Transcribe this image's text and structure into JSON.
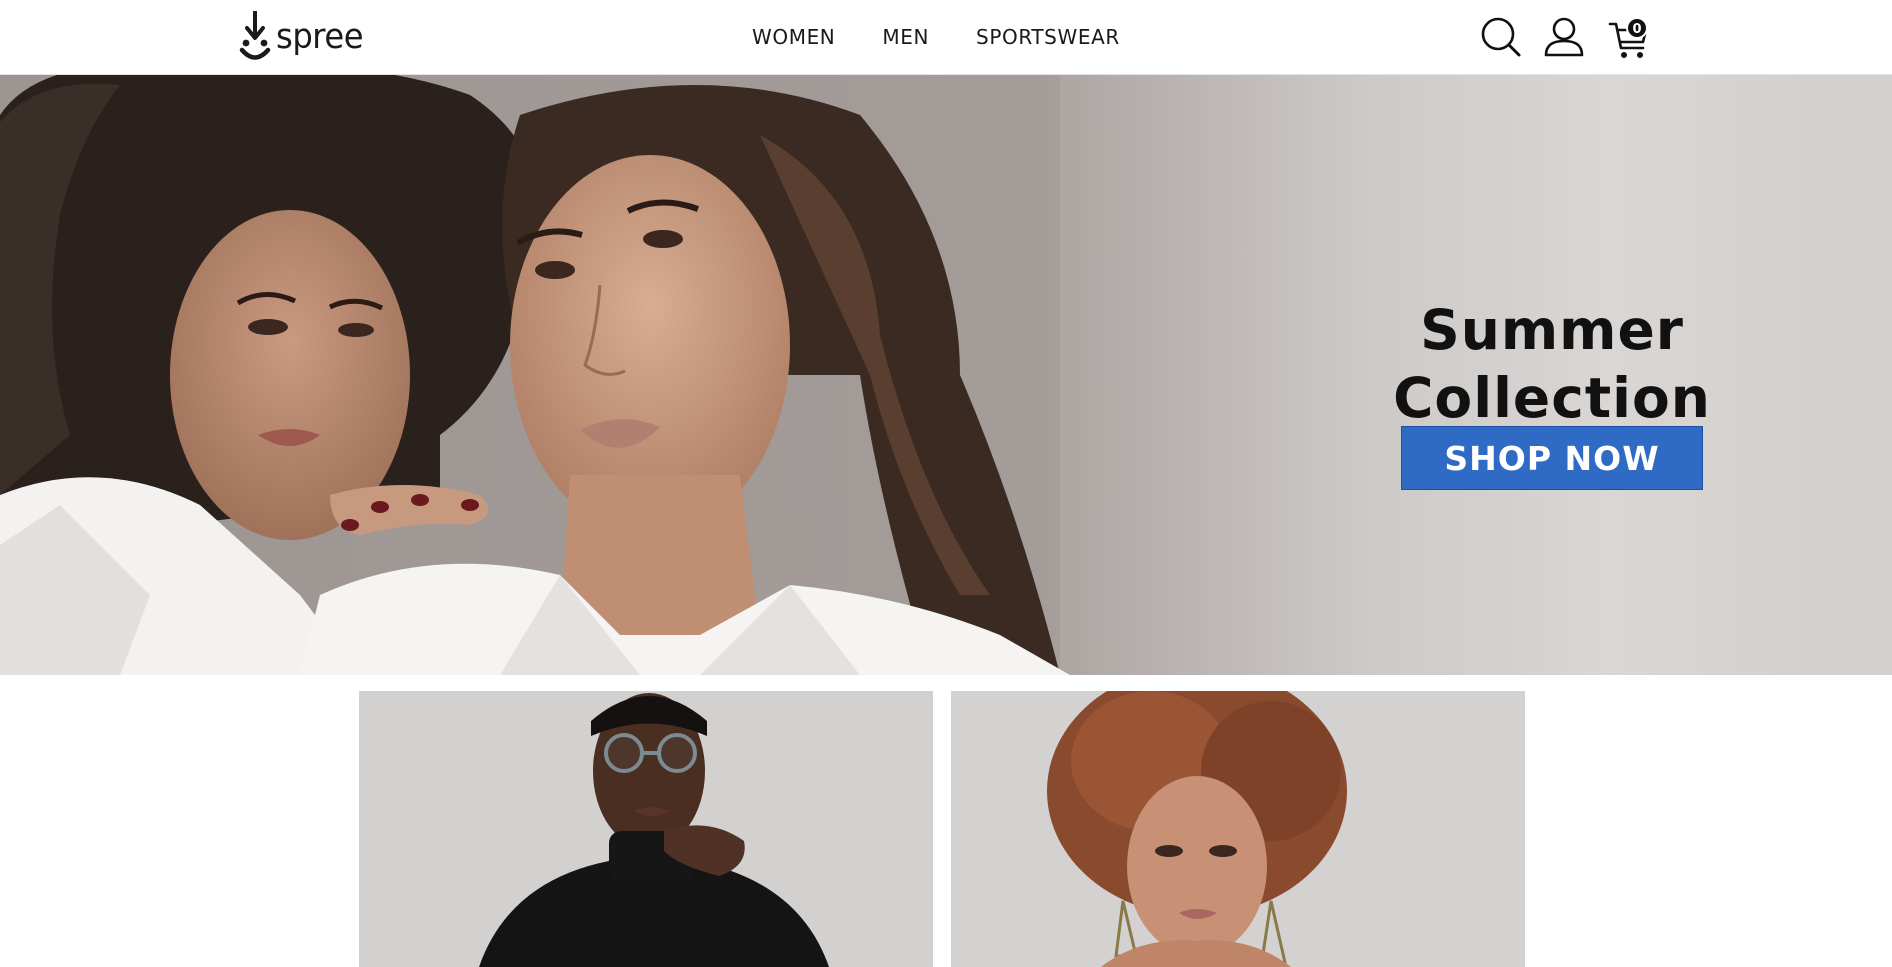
{
  "header": {
    "logo": {
      "text": "spree",
      "icon": "spree-logo-icon"
    },
    "nav": [
      {
        "label": "WOMEN"
      },
      {
        "label": "MEN"
      },
      {
        "label": "SPORTSWEAR"
      }
    ],
    "icons": {
      "search": "search-icon",
      "account": "user-icon",
      "cart": "cart-icon"
    },
    "cart_count": "0"
  },
  "hero": {
    "title_line1": "Summer",
    "title_line2": "Collection",
    "cta_label": "SHOP NOW",
    "cta_color": "#2f6ac5"
  },
  "tiles": [
    {
      "name": "men-category-image"
    },
    {
      "name": "women-category-image"
    }
  ]
}
